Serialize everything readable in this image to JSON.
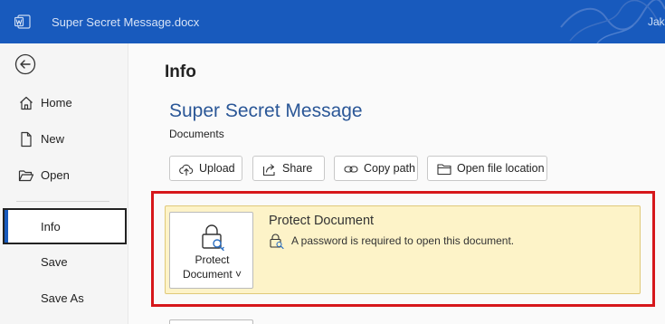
{
  "app": {
    "title": "Super Secret Message.docx",
    "user": "Jake",
    "brand_color": "#185abd"
  },
  "sidebar": {
    "back": {
      "icon": "back-arrow-icon"
    },
    "items": [
      {
        "label": "Home",
        "icon": "home-icon"
      },
      {
        "label": "New",
        "icon": "new-document-icon"
      },
      {
        "label": "Open",
        "icon": "open-folder-icon"
      },
      {
        "label": "Info",
        "active": true
      },
      {
        "label": "Save"
      },
      {
        "label": "Save As"
      }
    ]
  },
  "main": {
    "page_title": "Info",
    "document_name": "Super Secret Message",
    "document_location": "Documents",
    "actions": [
      {
        "label": "Upload",
        "icon": "upload-cloud-icon"
      },
      {
        "label": "Share",
        "icon": "share-icon"
      },
      {
        "label": "Copy path",
        "icon": "link-icon"
      },
      {
        "label": "Open file location",
        "icon": "folder-icon"
      }
    ],
    "protect": {
      "button_line1": "Protect",
      "button_line2": "Document ˅",
      "title": "Protect Document",
      "description": "A password is required to open this document.",
      "card_color": "#fdf3c8",
      "highlight_color": "#d6171b"
    }
  }
}
